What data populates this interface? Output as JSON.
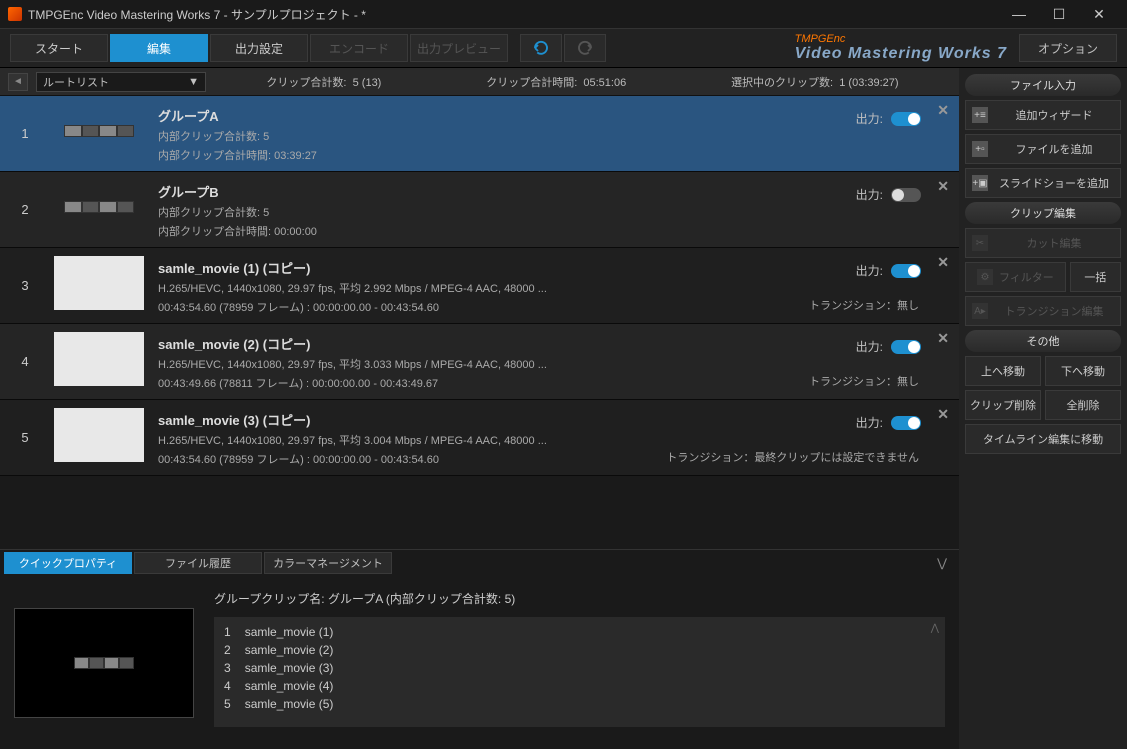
{
  "titlebar": {
    "title": "TMPGEnc Video Mastering Works 7 - サンプルプロジェクト - *"
  },
  "nav": {
    "start": "スタート",
    "edit": "編集",
    "output": "出力設定",
    "encode": "エンコード",
    "preview": "出力プレビュー",
    "option": "オプション"
  },
  "brand": {
    "small": "TMPGEnc",
    "main": "Video Mastering Works 7"
  },
  "strip": {
    "dropdown": "ルートリスト",
    "total_label": "クリップ合計数:",
    "total_value": "5 (13)",
    "time_label": "クリップ合計時間:",
    "time_value": "05:51:06",
    "sel_label": "選択中のクリップ数:",
    "sel_value": "1 (03:39:27)"
  },
  "clips": [
    {
      "num": "1",
      "type": "group",
      "title": "グループA",
      "line1": "内部クリップ合計数: 5",
      "line2": "内部クリップ合計時間: 03:39:27",
      "output": true,
      "selected": true
    },
    {
      "num": "2",
      "type": "group",
      "title": "グループB",
      "line1": "内部クリップ合計数: 5",
      "line2": "内部クリップ合計時間: 00:00:00",
      "output": false
    },
    {
      "num": "3",
      "type": "movie",
      "title": "samle_movie (1) (コピー)",
      "line1": "H.265/HEVC,  1440x1080,  29.97 fps,  平均 2.992 Mbps / MPEG-4 AAC,  48000 ...",
      "line2": "00:43:54.60 (78959 フレーム) :  00:00:00.00 - 00:43:54.60",
      "trans": "トランジション：無し",
      "output": true
    },
    {
      "num": "4",
      "type": "movie",
      "title": "samle_movie (2) (コピー)",
      "line1": "H.265/HEVC,  1440x1080,  29.97 fps,  平均 3.033 Mbps / MPEG-4 AAC,  48000 ...",
      "line2": "00:43:49.66 (78811 フレーム) :  00:00:00.00 - 00:43:49.67",
      "trans": "トランジション：無し",
      "output": true
    },
    {
      "num": "5",
      "type": "movie",
      "title": "samle_movie (3) (コピー)",
      "line1": "H.265/HEVC,  1440x1080,  29.97 fps,  平均 3.004 Mbps / MPEG-4 AAC,  48000 ...",
      "line2": "00:43:54.60 (78959 フレーム) :  00:00:00.00 - 00:43:54.60",
      "trans": "トランジション：最終クリップには設定できません",
      "output": true
    }
  ],
  "output_label": "出力:",
  "right": {
    "file_input": "ファイル入力",
    "add_wizard": "追加ウィザード",
    "add_file": "ファイルを追加",
    "add_slideshow": "スライドショーを追加",
    "clip_edit": "クリップ編集",
    "cut_edit": "カット編集",
    "filter": "フィルター",
    "batch": "一括",
    "transition_edit": "トランジション編集",
    "other": "その他",
    "move_up": "上へ移動",
    "move_down": "下へ移動",
    "clip_delete": "クリップ削除",
    "delete_all": "全削除",
    "timeline_move": "タイムライン編集に移動"
  },
  "bottom": {
    "tab_quick": "クイックプロパティ",
    "tab_history": "ファイル履歴",
    "tab_color": "カラーマネージメント",
    "group_title": "グループクリップ名: グループA (内部クリップ合計数: 5)",
    "items": [
      {
        "n": "1",
        "name": "samle_movie (1)"
      },
      {
        "n": "2",
        "name": "samle_movie (2)"
      },
      {
        "n": "3",
        "name": "samle_movie (3)"
      },
      {
        "n": "4",
        "name": "samle_movie (4)"
      },
      {
        "n": "5",
        "name": "samle_movie (5)"
      }
    ]
  }
}
